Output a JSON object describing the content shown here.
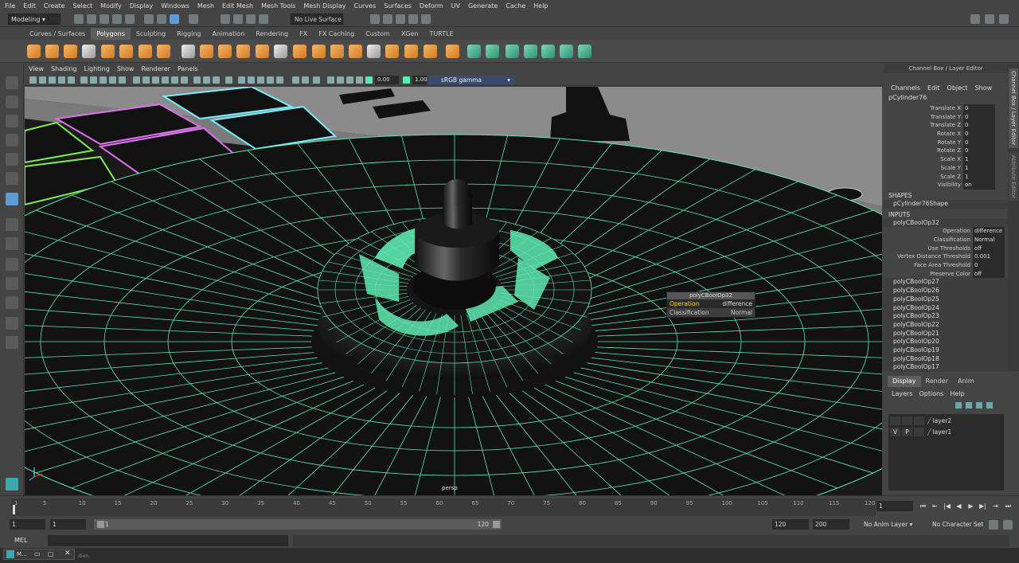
{
  "menubar": [
    "File",
    "Edit",
    "Create",
    "Select",
    "Modify",
    "Display",
    "Windows",
    "Mesh",
    "Edit Mesh",
    "Mesh Tools",
    "Mesh Display",
    "Curves",
    "Surfaces",
    "Deform",
    "UV",
    "Generate",
    "Cache",
    "Help"
  ],
  "status": {
    "mode": "Modeling",
    "live_surface": "No Live Surface"
  },
  "shelf_tabs": [
    "Curves / Surfaces",
    "Polygons",
    "Sculpting",
    "Rigging",
    "Animation",
    "Rendering",
    "FX",
    "FX Caching",
    "Custom",
    "XGen",
    "TURTLE"
  ],
  "shelf_active": "Polygons",
  "viewport": {
    "menu": [
      "View",
      "Shading",
      "Lighting",
      "Show",
      "Renderer",
      "Panels"
    ],
    "exposure": "0.00",
    "gamma": "1.00",
    "color_space": "sRGB gamma",
    "camera": "persp",
    "hud": {
      "title": "polyCBoolOp32",
      "rows": [
        {
          "label": "Operation",
          "value": "difference"
        },
        {
          "label": "Classification",
          "value": "Normal"
        }
      ]
    }
  },
  "channel_box": {
    "title": "Channel Box / Layer Editor",
    "menu": [
      "Channels",
      "Edit",
      "Object",
      "Show"
    ],
    "object": "pCylinder76",
    "attributes": [
      {
        "name": "Translate X",
        "value": "0"
      },
      {
        "name": "Translate Y",
        "value": "0"
      },
      {
        "name": "Translate Z",
        "value": "0"
      },
      {
        "name": "Rotate X",
        "value": "0"
      },
      {
        "name": "Rotate Y",
        "value": "0"
      },
      {
        "name": "Rotate Z",
        "value": "0"
      },
      {
        "name": "Scale X",
        "value": "1"
      },
      {
        "name": "Scale Y",
        "value": "1"
      },
      {
        "name": "Scale Z",
        "value": "1"
      },
      {
        "name": "Visibility",
        "value": "on"
      }
    ],
    "shapes_header": "SHAPES",
    "shape": "pCylinder76Shape",
    "inputs_header": "INPUTS",
    "input_node": "polyCBoolOp32",
    "input_attributes": [
      {
        "name": "Operation",
        "value": "difference"
      },
      {
        "name": "Classification",
        "value": "Normal"
      },
      {
        "name": "Use Thresholds",
        "value": "off"
      },
      {
        "name": "Vertex Distance Threshold",
        "value": "0.001"
      },
      {
        "name": "Face Area Threshold",
        "value": "0"
      },
      {
        "name": "Preserve Color",
        "value": "off"
      }
    ],
    "other_inputs": [
      "polyCBoolOp27",
      "polyCBoolOp26",
      "polyCBoolOp25",
      "polyCBoolOp24",
      "polyCBoolOp23",
      "polyCBoolOp22",
      "polyCBoolOp21",
      "polyCBoolOp20",
      "polyCBoolOp19",
      "polyCBoolOp18",
      "polyCBoolOp17"
    ]
  },
  "side_tabs": [
    "Channel Box / Layer Editor",
    "Attribute Editor"
  ],
  "layer_editor": {
    "tabs": [
      "Display",
      "Render",
      "Anim"
    ],
    "active_tab": "Display",
    "menu": [
      "Layers",
      "Options",
      "Help"
    ],
    "layers": [
      {
        "v": "",
        "p": "",
        "name": "layer2"
      },
      {
        "v": "V",
        "p": "P",
        "name": "layer1"
      }
    ]
  },
  "timeline": {
    "ticks": [
      "1",
      "5",
      "10",
      "15",
      "20",
      "25",
      "30",
      "35",
      "40",
      "45",
      "50",
      "55",
      "60",
      "65",
      "70",
      "75",
      "80",
      "85",
      "90",
      "95",
      "100",
      "105",
      "110",
      "115",
      "120"
    ],
    "current_frame": "1",
    "range_start": "1",
    "playback_start": "1",
    "range_inner_start": "1",
    "range_inner_end": "120",
    "range_end": "120",
    "anim_end": "200",
    "anim_layer": "No Anim Layer",
    "character_set": "No Character Set"
  },
  "command_line": {
    "label": "MEL"
  },
  "taskbar": {
    "window_label": "M...",
    "status_fragment": "ition."
  },
  "colors": {
    "wire": "#5ee8b0",
    "accent_blue": "#5d9bd5",
    "selection_yellow": "#ffde00"
  }
}
